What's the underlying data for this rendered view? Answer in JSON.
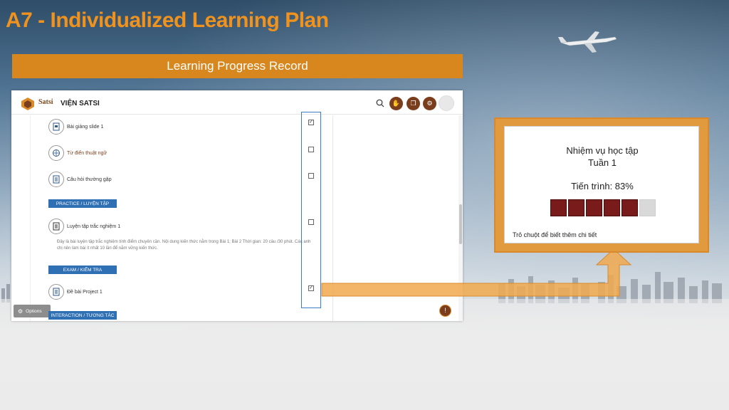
{
  "slide": {
    "title": "A7 - Individualized Learning Plan",
    "banner": "Learning Progress Record"
  },
  "colors": {
    "title": "#f0921e",
    "banner": "#d8871f",
    "section_button": "#2f6fb4",
    "progress_fill": "#7a1b1b",
    "brand_brown": "#7a3e1c"
  },
  "header": {
    "brand": "Satsi",
    "site_name": "VIỆN SATSI",
    "icons": [
      "search-icon",
      "hand-icon",
      "chat-icon",
      "settings-icon",
      "avatar"
    ]
  },
  "course": {
    "items": [
      {
        "label": "Bài giảng slide 1",
        "icon": "slide-icon",
        "checked": true
      },
      {
        "label": "Từ điển thuật ngữ",
        "icon": "globe-icon",
        "checked": false
      },
      {
        "label": "Câu hỏi thường gặp",
        "icon": "document-icon",
        "checked": false
      },
      {
        "label": "Luyện tập trắc nghiệm 1",
        "icon": "quiz-icon",
        "checked": false
      },
      {
        "label": "Đề bài Project 1",
        "icon": "document-icon",
        "checked": true
      }
    ],
    "sections": [
      "PRACTICE / LUYỆN TẬP",
      "EXAM / KIỂM TRA",
      "INTERACTION / TƯƠNG TÁC"
    ],
    "quiz_description": "Đây là bài luyện tập trắc nghiệm tính điểm chuyên cần. Nội dung kiến thức nằm trong Bài 1; Bài 2 Thời gian: 20 câu /30 phút. Các anh chị nên làm bài ít nhất 10 lần để nắm vững kiến thức.",
    "options_label": "Options"
  },
  "popup": {
    "title": "Nhiệm vụ học tập",
    "week": "Tuần 1",
    "progress_label": "Tiến trình: 83%",
    "progress_value": 0.83,
    "segments_filled": 5,
    "segments_total": 6,
    "hint": "Trỏ chuột để biết thêm chi tiết"
  }
}
